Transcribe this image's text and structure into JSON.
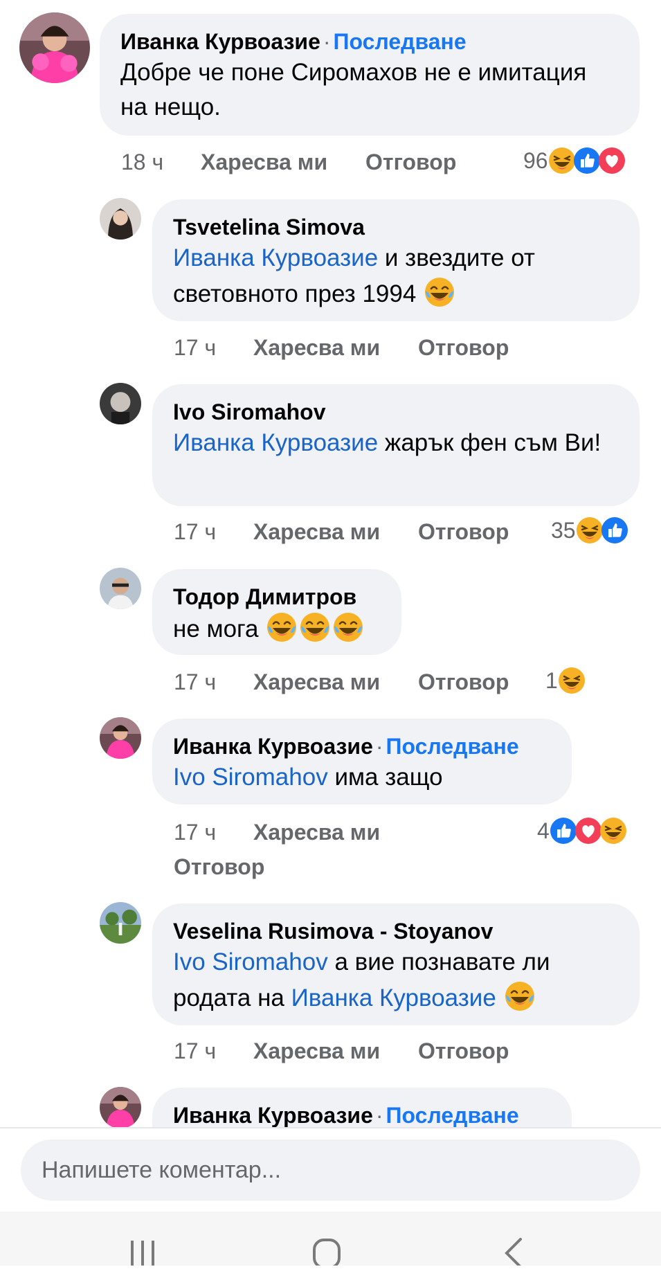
{
  "comments": [
    {
      "name": "Иванка Курвоазие",
      "follow": "Последване",
      "text": "Добре че поне Сиромахов не е имитация на нещо.",
      "time": "18 ч",
      "like": "Харесва ми",
      "reply": "Отговор",
      "reactions_count": "96",
      "reactions": [
        "haha-icon",
        "like-icon",
        "love-icon"
      ]
    },
    {
      "name": "Tsvetelina Simova",
      "mention": "Иванка Курвоазие",
      "text": " и звездите от световното през 1994 ",
      "time": "17 ч",
      "like": "Харесва ми",
      "reply": "Отговор",
      "text_emoji": [
        "tears-of-joy-icon"
      ]
    },
    {
      "name": "Ivo Siromahov",
      "mention": "Иванка Курвоазие",
      "text": " жарък фен съм Ви!",
      "time": "17 ч",
      "like": "Харесва ми",
      "reply": "Отговор",
      "reactions_count": "35",
      "reactions": [
        "haha-icon",
        "like-icon"
      ]
    },
    {
      "name": "Тодор Димитров",
      "text": "не мога ",
      "time": "17 ч",
      "like": "Харесва ми",
      "reply": "Отговор",
      "reactions_count": "1",
      "reactions": [
        "haha-icon"
      ],
      "text_emoji": [
        "tears-of-joy-icon",
        "tears-of-joy-icon",
        "tears-of-joy-icon"
      ]
    },
    {
      "name": "Иванка Курвоазие",
      "follow": "Последване",
      "mention": "Ivo Siromahov",
      "text": " има защо",
      "time": "17 ч",
      "like": "Харесва ми",
      "reply": "Отговор",
      "reactions_count": "4",
      "reactions": [
        "like-icon",
        "love-icon",
        "haha-icon"
      ]
    },
    {
      "name": "Veselina Rusimova - Stoyanov",
      "mention": "Ivo Siromahov",
      "text_a": " а вие познавате ли родата на ",
      "mention2": "Иванка Курвоазие",
      "time": "17 ч",
      "like": "Харесва ми",
      "reply": "Отговор",
      "text_emoji": [
        "tears-of-joy-icon"
      ]
    },
    {
      "name": "Иванка Курвоазие",
      "follow": "Последване"
    }
  ],
  "composer": {
    "placeholder": "Напишете коментар..."
  },
  "separator": "·",
  "colors": {
    "accent": "#1877f2",
    "mention": "#1964c8",
    "bubble": "#f0f2f5",
    "secondary": "#65676b"
  },
  "navbar": {
    "icons": [
      "recent-apps-icon",
      "home-icon",
      "back-icon"
    ]
  }
}
